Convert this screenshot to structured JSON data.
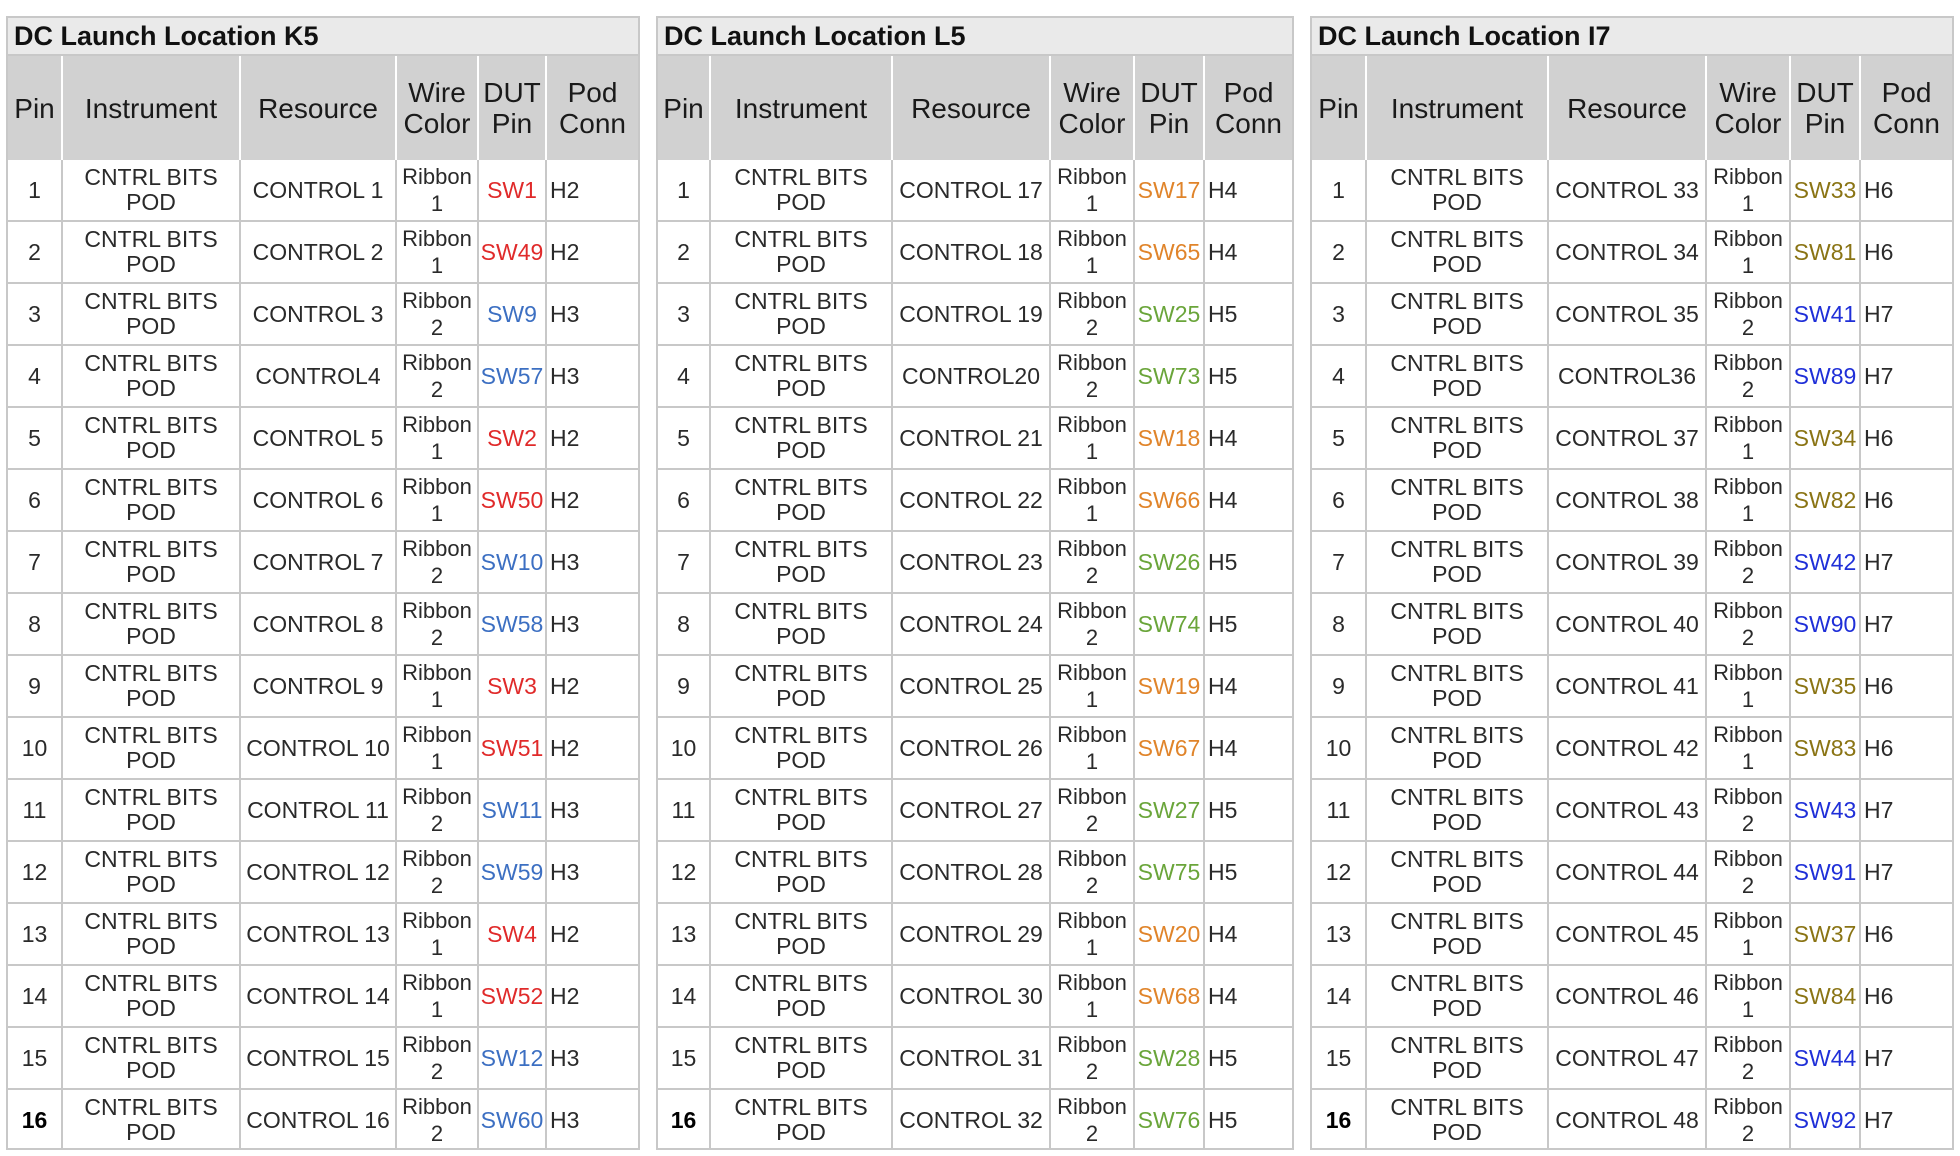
{
  "common": {
    "headers": [
      "Pin",
      "Instrument",
      "Resource",
      "Wire Color",
      "DUT Pin",
      "Pod Conn"
    ],
    "instrument": "CNTRL BITS POD"
  },
  "colors": {
    "red": "#e02a2a",
    "blue": "#3c6fc2",
    "orange": "#e0842a",
    "green": "#6aa53a",
    "olive": "#8a7414",
    "navy": "#1f2fd8"
  },
  "panels": [
    {
      "title": "DC Launch Location K5",
      "rows": [
        {
          "pin": "1",
          "instrument": "CNTRL BITS POD",
          "resource": "CONTROL 1",
          "wire": "Ribbon 1",
          "dut": "SW1",
          "dut_color": "red",
          "conn": "H2"
        },
        {
          "pin": "2",
          "instrument": "CNTRL BITS POD",
          "resource": "CONTROL 2",
          "wire": "Ribbon 1",
          "dut": "SW49",
          "dut_color": "red",
          "conn": "H2"
        },
        {
          "pin": "3",
          "instrument": "CNTRL BITS POD",
          "resource": "CONTROL 3",
          "wire": "Ribbon 2",
          "dut": "SW9",
          "dut_color": "blue",
          "conn": "H3"
        },
        {
          "pin": "4",
          "instrument": "CNTRL BITS POD",
          "resource": "CONTROL4",
          "wire": "Ribbon 2",
          "dut": "SW57",
          "dut_color": "blue",
          "conn": "H3"
        },
        {
          "pin": "5",
          "instrument": "CNTRL BITS POD",
          "resource": "CONTROL 5",
          "wire": "Ribbon 1",
          "dut": "SW2",
          "dut_color": "red",
          "conn": "H2"
        },
        {
          "pin": "6",
          "instrument": "CNTRL BITS POD",
          "resource": "CONTROL 6",
          "wire": "Ribbon 1",
          "dut": "SW50",
          "dut_color": "red",
          "conn": "H2"
        },
        {
          "pin": "7",
          "instrument": "CNTRL BITS POD",
          "resource": "CONTROL 7",
          "wire": "Ribbon 2",
          "dut": "SW10",
          "dut_color": "blue",
          "conn": "H3"
        },
        {
          "pin": "8",
          "instrument": "CNTRL BITS POD",
          "resource": "CONTROL 8",
          "wire": "Ribbon 2",
          "dut": "SW58",
          "dut_color": "blue",
          "conn": "H3"
        },
        {
          "pin": "9",
          "instrument": "CNTRL BITS POD",
          "resource": "CONTROL 9",
          "wire": "Ribbon 1",
          "dut": "SW3",
          "dut_color": "red",
          "conn": "H2"
        },
        {
          "pin": "10",
          "instrument": "CNTRL BITS POD",
          "resource": "CONTROL 10",
          "wire": "Ribbon 1",
          "dut": "SW51",
          "dut_color": "red",
          "conn": "H2"
        },
        {
          "pin": "11",
          "instrument": "CNTRL BITS POD",
          "resource": "CONTROL 11",
          "wire": "Ribbon 2",
          "dut": "SW11",
          "dut_color": "blue",
          "conn": "H3"
        },
        {
          "pin": "12",
          "instrument": "CNTRL BITS POD",
          "resource": "CONTROL 12",
          "wire": "Ribbon 2",
          "dut": "SW59",
          "dut_color": "blue",
          "conn": "H3"
        },
        {
          "pin": "13",
          "instrument": "CNTRL BITS POD",
          "resource": "CONTROL 13",
          "wire": "Ribbon 1",
          "dut": "SW4",
          "dut_color": "red",
          "conn": "H2"
        },
        {
          "pin": "14",
          "instrument": "CNTRL BITS POD",
          "resource": "CONTROL 14",
          "wire": "Ribbon 1",
          "dut": "SW52",
          "dut_color": "red",
          "conn": "H2"
        },
        {
          "pin": "15",
          "instrument": "CNTRL BITS POD",
          "resource": "CONTROL 15",
          "wire": "Ribbon 2",
          "dut": "SW12",
          "dut_color": "blue",
          "conn": "H3"
        },
        {
          "pin": "16",
          "instrument": "CNTRL BITS POD",
          "resource": "CONTROL 16",
          "wire": "Ribbon 2",
          "dut": "SW60",
          "dut_color": "blue",
          "conn": "H3"
        }
      ]
    },
    {
      "title": "DC Launch Location L5",
      "rows": [
        {
          "pin": "1",
          "instrument": "CNTRL BITS POD",
          "resource": "CONTROL 17",
          "wire": "Ribbon 1",
          "dut": "SW17",
          "dut_color": "orange",
          "conn": "H4"
        },
        {
          "pin": "2",
          "instrument": "CNTRL BITS POD",
          "resource": "CONTROL 18",
          "wire": "Ribbon 1",
          "dut": "SW65",
          "dut_color": "orange",
          "conn": "H4"
        },
        {
          "pin": "3",
          "instrument": "CNTRL BITS POD",
          "resource": "CONTROL 19",
          "wire": "Ribbon 2",
          "dut": "SW25",
          "dut_color": "green",
          "conn": "H5"
        },
        {
          "pin": "4",
          "instrument": "CNTRL BITS POD",
          "resource": "CONTROL20",
          "wire": "Ribbon 2",
          "dut": "SW73",
          "dut_color": "green",
          "conn": "H5"
        },
        {
          "pin": "5",
          "instrument": "CNTRL BITS POD",
          "resource": "CONTROL 21",
          "wire": "Ribbon 1",
          "dut": "SW18",
          "dut_color": "orange",
          "conn": "H4"
        },
        {
          "pin": "6",
          "instrument": "CNTRL BITS POD",
          "resource": "CONTROL 22",
          "wire": "Ribbon 1",
          "dut": "SW66",
          "dut_color": "orange",
          "conn": "H4"
        },
        {
          "pin": "7",
          "instrument": "CNTRL BITS POD",
          "resource": "CONTROL 23",
          "wire": "Ribbon 2",
          "dut": "SW26",
          "dut_color": "green",
          "conn": "H5"
        },
        {
          "pin": "8",
          "instrument": "CNTRL BITS POD",
          "resource": "CONTROL 24",
          "wire": "Ribbon 2",
          "dut": "SW74",
          "dut_color": "green",
          "conn": "H5"
        },
        {
          "pin": "9",
          "instrument": "CNTRL BITS POD",
          "resource": "CONTROL 25",
          "wire": "Ribbon 1",
          "dut": "SW19",
          "dut_color": "orange",
          "conn": "H4"
        },
        {
          "pin": "10",
          "instrument": "CNTRL BITS POD",
          "resource": "CONTROL 26",
          "wire": "Ribbon 1",
          "dut": "SW67",
          "dut_color": "orange",
          "conn": "H4"
        },
        {
          "pin": "11",
          "instrument": "CNTRL BITS POD",
          "resource": "CONTROL 27",
          "wire": "Ribbon 2",
          "dut": "SW27",
          "dut_color": "green",
          "conn": "H5"
        },
        {
          "pin": "12",
          "instrument": "CNTRL BITS POD",
          "resource": "CONTROL 28",
          "wire": "Ribbon 2",
          "dut": "SW75",
          "dut_color": "green",
          "conn": "H5"
        },
        {
          "pin": "13",
          "instrument": "CNTRL BITS POD",
          "resource": "CONTROL 29",
          "wire": "Ribbon 1",
          "dut": "SW20",
          "dut_color": "orange",
          "conn": "H4"
        },
        {
          "pin": "14",
          "instrument": "CNTRL BITS POD",
          "resource": "CONTROL 30",
          "wire": "Ribbon 1",
          "dut": "SW68",
          "dut_color": "orange",
          "conn": "H4"
        },
        {
          "pin": "15",
          "instrument": "CNTRL BITS POD",
          "resource": "CONTROL 31",
          "wire": "Ribbon 2",
          "dut": "SW28",
          "dut_color": "green",
          "conn": "H5"
        },
        {
          "pin": "16",
          "instrument": "CNTRL BITS POD",
          "resource": "CONTROL 32",
          "wire": "Ribbon 2",
          "dut": "SW76",
          "dut_color": "green",
          "conn": "H5"
        }
      ]
    },
    {
      "title": "DC Launch Location I7",
      "rows": [
        {
          "pin": "1",
          "instrument": "CNTRL BITS POD",
          "resource": "CONTROL 33",
          "wire": "Ribbon 1",
          "dut": "SW33",
          "dut_color": "olive",
          "conn": "H6"
        },
        {
          "pin": "2",
          "instrument": "CNTRL BITS POD",
          "resource": "CONTROL 34",
          "wire": "Ribbon 1",
          "dut": "SW81",
          "dut_color": "olive",
          "conn": "H6"
        },
        {
          "pin": "3",
          "instrument": "CNTRL BITS POD",
          "resource": "CONTROL 35",
          "wire": "Ribbon 2",
          "dut": "SW41",
          "dut_color": "navy",
          "conn": "H7"
        },
        {
          "pin": "4",
          "instrument": "CNTRL BITS POD",
          "resource": "CONTROL36",
          "wire": "Ribbon 2",
          "dut": "SW89",
          "dut_color": "navy",
          "conn": "H7"
        },
        {
          "pin": "5",
          "instrument": "CNTRL BITS POD",
          "resource": "CONTROL 37",
          "wire": "Ribbon 1",
          "dut": "SW34",
          "dut_color": "olive",
          "conn": "H6"
        },
        {
          "pin": "6",
          "instrument": "CNTRL BITS POD",
          "resource": "CONTROL 38",
          "wire": "Ribbon 1",
          "dut": "SW82",
          "dut_color": "olive",
          "conn": "H6"
        },
        {
          "pin": "7",
          "instrument": "CNTRL BITS POD",
          "resource": "CONTROL 39",
          "wire": "Ribbon 2",
          "dut": "SW42",
          "dut_color": "navy",
          "conn": "H7"
        },
        {
          "pin": "8",
          "instrument": "CNTRL BITS POD",
          "resource": "CONTROL 40",
          "wire": "Ribbon 2",
          "dut": "SW90",
          "dut_color": "navy",
          "conn": "H7"
        },
        {
          "pin": "9",
          "instrument": "CNTRL BITS POD",
          "resource": "CONTROL 41",
          "wire": "Ribbon 1",
          "dut": "SW35",
          "dut_color": "olive",
          "conn": "H6"
        },
        {
          "pin": "10",
          "instrument": "CNTRL BITS POD",
          "resource": "CONTROL 42",
          "wire": "Ribbon 1",
          "dut": "SW83",
          "dut_color": "olive",
          "conn": "H6"
        },
        {
          "pin": "11",
          "instrument": "CNTRL BITS POD",
          "resource": "CONTROL 43",
          "wire": "Ribbon 2",
          "dut": "SW43",
          "dut_color": "navy",
          "conn": "H7"
        },
        {
          "pin": "12",
          "instrument": "CNTRL BITS POD",
          "resource": "CONTROL 44",
          "wire": "Ribbon 2",
          "dut": "SW91",
          "dut_color": "navy",
          "conn": "H7"
        },
        {
          "pin": "13",
          "instrument": "CNTRL BITS POD",
          "resource": "CONTROL 45",
          "wire": "Ribbon 1",
          "dut": "SW37",
          "dut_color": "olive",
          "conn": "H6"
        },
        {
          "pin": "14",
          "instrument": "CNTRL BITS POD",
          "resource": "CONTROL 46",
          "wire": "Ribbon 1",
          "dut": "SW84",
          "dut_color": "olive",
          "conn": "H6"
        },
        {
          "pin": "15",
          "instrument": "CNTRL BITS POD",
          "resource": "CONTROL 47",
          "wire": "Ribbon 2",
          "dut": "SW44",
          "dut_color": "navy",
          "conn": "H7"
        },
        {
          "pin": "16",
          "instrument": "CNTRL BITS POD",
          "resource": "CONTROL 48",
          "wire": "Ribbon 2",
          "dut": "SW92",
          "dut_color": "navy",
          "conn": "H7"
        }
      ]
    }
  ]
}
